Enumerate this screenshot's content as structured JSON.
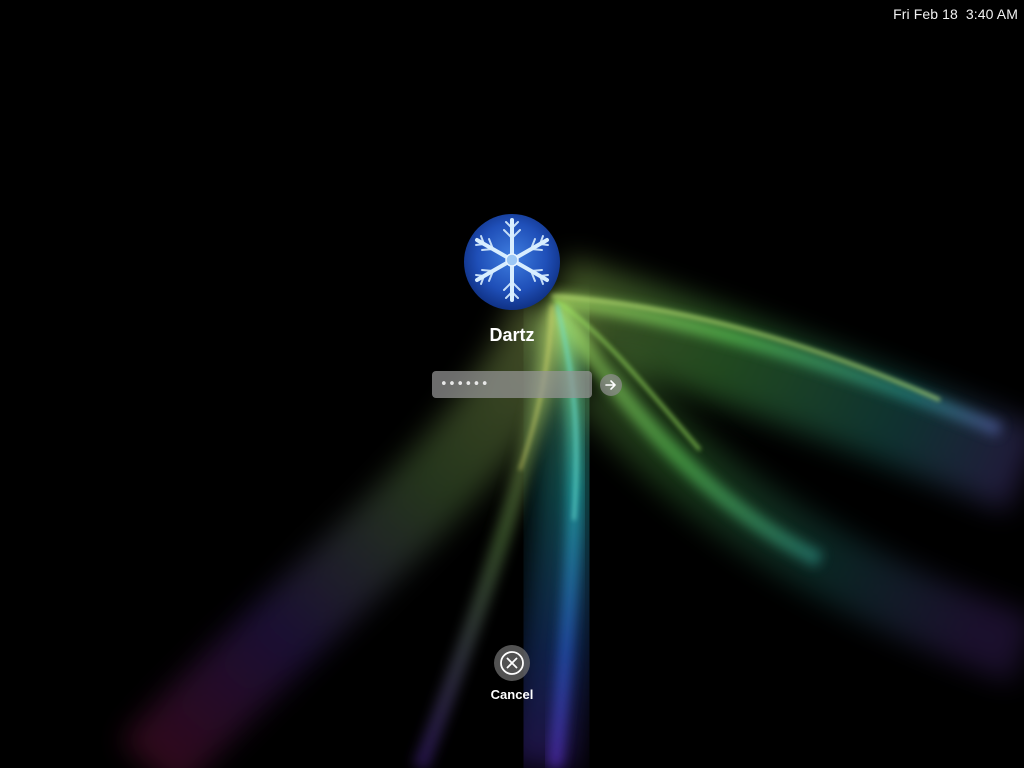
{
  "menubar": {
    "clock": "Fri Feb 18  3:40 AM"
  },
  "login": {
    "username": "Dartz",
    "password_value": "••••••",
    "avatar_icon": "snowflake-icon",
    "submit_icon": "arrow-right-icon"
  },
  "cancel": {
    "label": "Cancel",
    "icon": "close-icon"
  },
  "colors": {
    "background": "#000000",
    "aurora_green": "#7ee05a",
    "aurora_teal": "#2bc0c0",
    "aurora_purple": "#7a3fd0",
    "avatar_blue": "#1f4fb8"
  }
}
